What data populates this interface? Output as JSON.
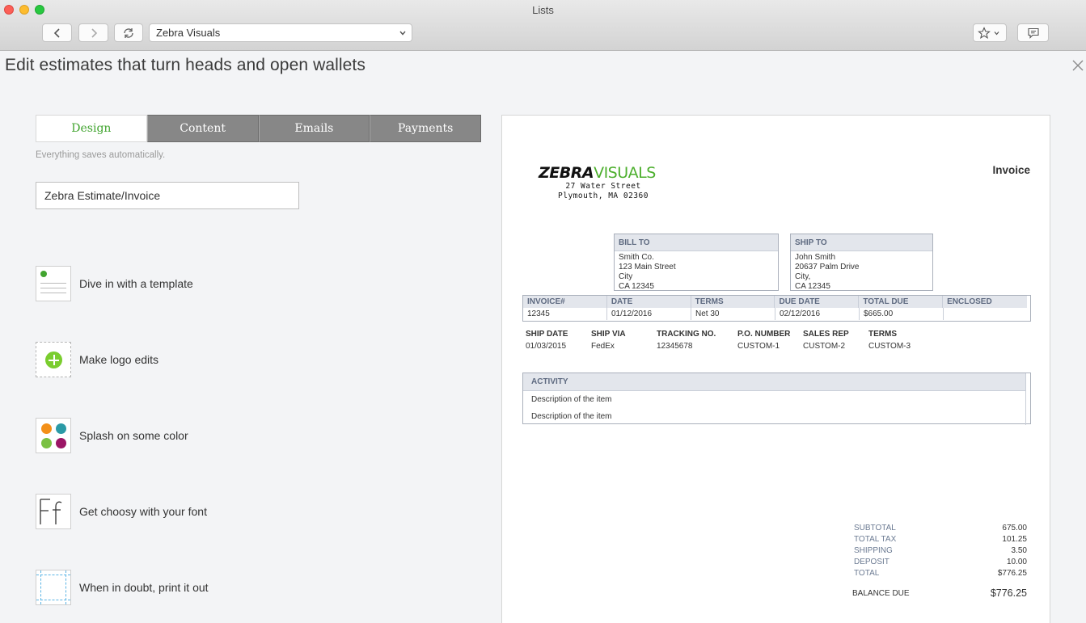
{
  "window": {
    "title": "Lists",
    "address_value": "Zebra Visuals"
  },
  "page": {
    "title": "Edit estimates that turn heads and open wallets"
  },
  "tabs": [
    {
      "label": "Design",
      "active": true
    },
    {
      "label": "Content",
      "active": false
    },
    {
      "label": "Emails",
      "active": false
    },
    {
      "label": "Payments",
      "active": false
    }
  ],
  "autosave_note": "Everything saves automatically.",
  "template_name": "Zebra Estimate/Invoice",
  "features": [
    {
      "label": "Dive in with a template",
      "icon": "template-icon"
    },
    {
      "label": "Make logo edits",
      "icon": "add-logo-icon"
    },
    {
      "label": "Splash on some color",
      "icon": "color-palette-icon"
    },
    {
      "label": "Get choosy with your font",
      "icon": "font-icon"
    },
    {
      "label": "When in doubt, print it out",
      "icon": "print-margins-icon"
    }
  ],
  "colors": {
    "accent": "#41a42f",
    "palette": [
      "#f39019",
      "#2b9aa6",
      "#7ac143",
      "#9b1565"
    ]
  },
  "invoice": {
    "logo": {
      "part1": "ZEBRA",
      "part2": "VISUALS"
    },
    "company_address": [
      "27 Water Street",
      "Plymouth, MA 02360"
    ],
    "doc_title": "Invoice",
    "bill_to": {
      "heading": "BILL TO",
      "lines": [
        "Smith Co.",
        "123 Main Street",
        "City",
        "CA 12345"
      ]
    },
    "ship_to": {
      "heading": "SHIP TO",
      "lines": [
        "John Smith",
        "20637 Palm Drive",
        "City,",
        "CA 12345"
      ]
    },
    "summary_headers": [
      "INVOICE#",
      "DATE",
      "TERMS",
      "DUE DATE",
      "TOTAL DUE",
      "ENCLOSED"
    ],
    "summary_values": [
      "12345",
      "01/12/2016",
      "Net 30",
      "02/12/2016",
      "$665.00",
      ""
    ],
    "shipping_fields": [
      {
        "label": "SHIP DATE",
        "value": "01/03/2015"
      },
      {
        "label": "SHIP VIA",
        "value": "FedEx"
      },
      {
        "label": "TRACKING NO.",
        "value": "12345678"
      },
      {
        "label": "P.O. NUMBER",
        "value": "CUSTOM-1"
      },
      {
        "label": "SALES REP",
        "value": "CUSTOM-2"
      },
      {
        "label": "TERMS",
        "value": "CUSTOM-3"
      }
    ],
    "activity_heading": "ACTIVITY",
    "activity_rows": [
      "Description of the item",
      "Description of the item"
    ],
    "totals": [
      {
        "label": "SUBTOTAL",
        "value": "675.00"
      },
      {
        "label": "TOTAL TAX",
        "value": "101.25"
      },
      {
        "label": "SHIPPING",
        "value": "3.50"
      },
      {
        "label": "DEPOSIT",
        "value": "10.00"
      },
      {
        "label": "TOTAL",
        "value": "$776.25"
      }
    ],
    "balance_due": {
      "label": "BALANCE DUE",
      "value": "$776.25"
    }
  }
}
